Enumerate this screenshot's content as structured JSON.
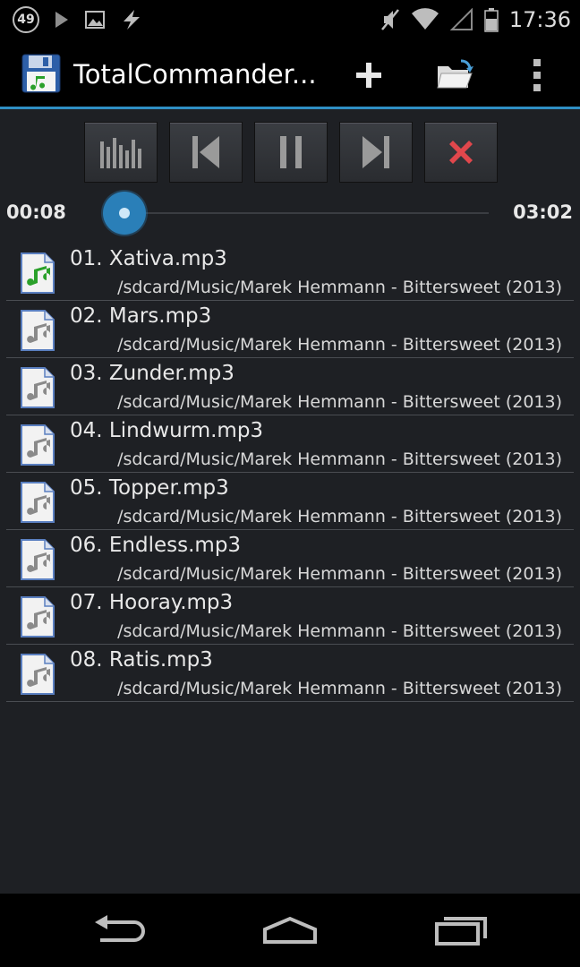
{
  "status_bar": {
    "notification_count": "49",
    "time": "17:36"
  },
  "action_bar": {
    "title": "TotalCommander..."
  },
  "player": {
    "elapsed": "00:08",
    "duration": "03:02",
    "progress": 0.044
  },
  "tracks": [
    {
      "name": "01. Xativa.mp3",
      "path": "/sdcard/Music/Marek Hemmann - Bittersweet (2013)",
      "playing": true
    },
    {
      "name": "02. Mars.mp3",
      "path": "/sdcard/Music/Marek Hemmann - Bittersweet (2013)"
    },
    {
      "name": "03. Zunder.mp3",
      "path": "/sdcard/Music/Marek Hemmann - Bittersweet (2013)"
    },
    {
      "name": "04. Lindwurm.mp3",
      "path": "/sdcard/Music/Marek Hemmann - Bittersweet (2013)"
    },
    {
      "name": "05. Topper.mp3",
      "path": "/sdcard/Music/Marek Hemmann - Bittersweet (2013)"
    },
    {
      "name": "06. Endless.mp3",
      "path": "/sdcard/Music/Marek Hemmann - Bittersweet (2013)"
    },
    {
      "name": "07. Hooray.mp3",
      "path": "/sdcard/Music/Marek Hemmann - Bittersweet (2013)"
    },
    {
      "name": "08. Ratis.mp3",
      "path": "/sdcard/Music/Marek Hemmann - Bittersweet (2013)"
    }
  ],
  "colors": {
    "accent": "#2f8fc4",
    "playing_note": "#2aa02a",
    "idle_note": "#8a8a8a",
    "stop_x": "#e0474c"
  }
}
